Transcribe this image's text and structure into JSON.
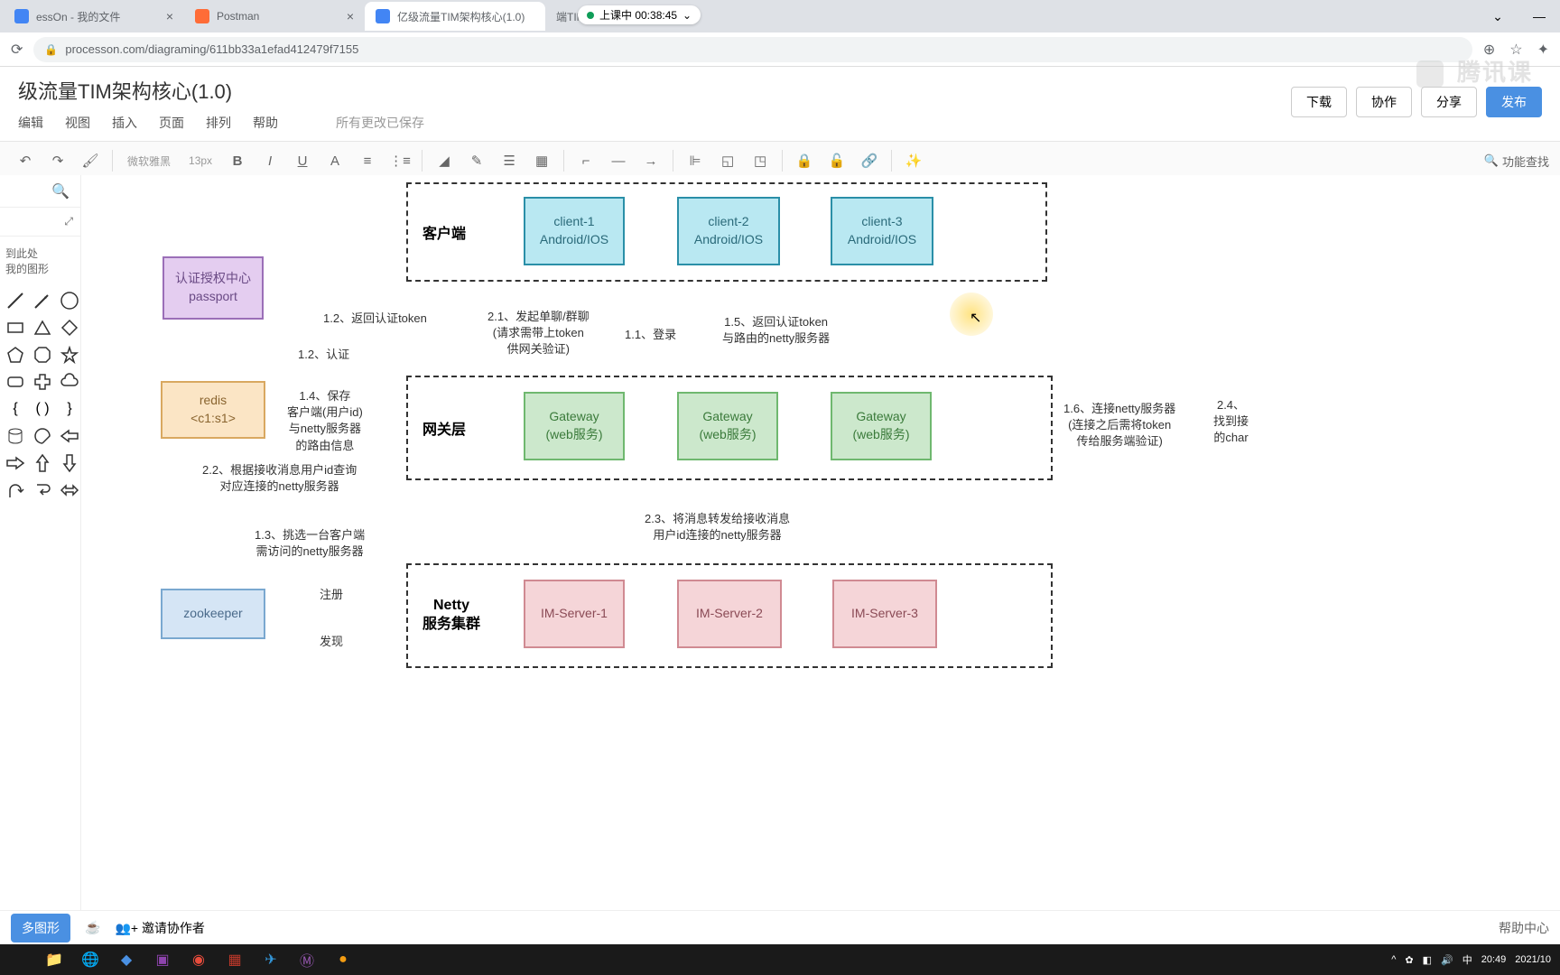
{
  "browser": {
    "tabs": [
      {
        "title": "essOn - 我的文件",
        "icon": "blue"
      },
      {
        "title": "Postman",
        "icon": "orange"
      },
      {
        "title": "亿级流量TIM架构核心(1.0)",
        "icon": "blue",
        "active": true
      },
      {
        "title": "端TIM架构核",
        "icon": "gray"
      }
    ],
    "recording": "上课中 00:38:45",
    "url": "processon.com/diagraming/611bb33a1efad412479f7155"
  },
  "app": {
    "docTitle": "级流量TIM架构核心(1.0)",
    "menu": [
      "编辑",
      "视图",
      "插入",
      "页面",
      "排列",
      "帮助"
    ],
    "savedStatus": "所有更改已保存",
    "actions": {
      "download": "下载",
      "collab": "协作",
      "share": "分享",
      "publish": "发布"
    }
  },
  "toolbar": {
    "font": "微软雅黑",
    "fontSize": "13px",
    "searchLabel": "功能查找"
  },
  "sidePanel": {
    "dragHint": "到此处\n我的图形",
    "moreShapes": "多图形"
  },
  "diagram": {
    "groups": {
      "client": "客户端",
      "gateway": "网关层",
      "netty": "Netty\n服务集群"
    },
    "nodes": {
      "auth": "认证授权中心\npassport",
      "redis": "redis\n<c1:s1>",
      "zk": "zookeeper",
      "c1": "client-1\nAndroid/IOS",
      "c2": "client-2\nAndroid/IOS",
      "c3": "client-3\nAndroid/IOS",
      "g1": "Gateway\n(web服务)",
      "g2": "Gateway\n(web服务)",
      "g3": "Gateway\n(web服务)",
      "s1": "IM-Server-1",
      "s2": "IM-Server-2",
      "s3": "IM-Server-3"
    },
    "edges": {
      "e11": "1.1、登录",
      "e12a": "1.2、返回认证token",
      "e12b": "1.2、认证",
      "e13": "1.3、挑选一台客户端\n需访问的netty服务器",
      "e14": "1.4、保存\n客户端(用户id)\n与netty服务器\n的路由信息",
      "e15": "1.5、返回认证token\n与路由的netty服务器",
      "e16": "1.6、连接netty服务器\n(连接之后需将token\n传给服务端验证)",
      "e21": "2.1、发起单聊/群聊\n(请求需带上token\n供网关验证)",
      "e22": "2.2、根据接收消息用户id查询\n对应连接的netty服务器",
      "e23": "2.3、将消息转发给接收消息\n用户id连接的netty服务器",
      "e24": "2.4、\n找到接\n的char",
      "reg": "注册",
      "disc": "发现"
    }
  },
  "bottomBar": {
    "invite": "邀请协作者",
    "help": "帮助中心"
  },
  "taskbar": {
    "time": "20:49",
    "date": "2021/10",
    "ime": "中"
  },
  "watermark": "腾讯课"
}
